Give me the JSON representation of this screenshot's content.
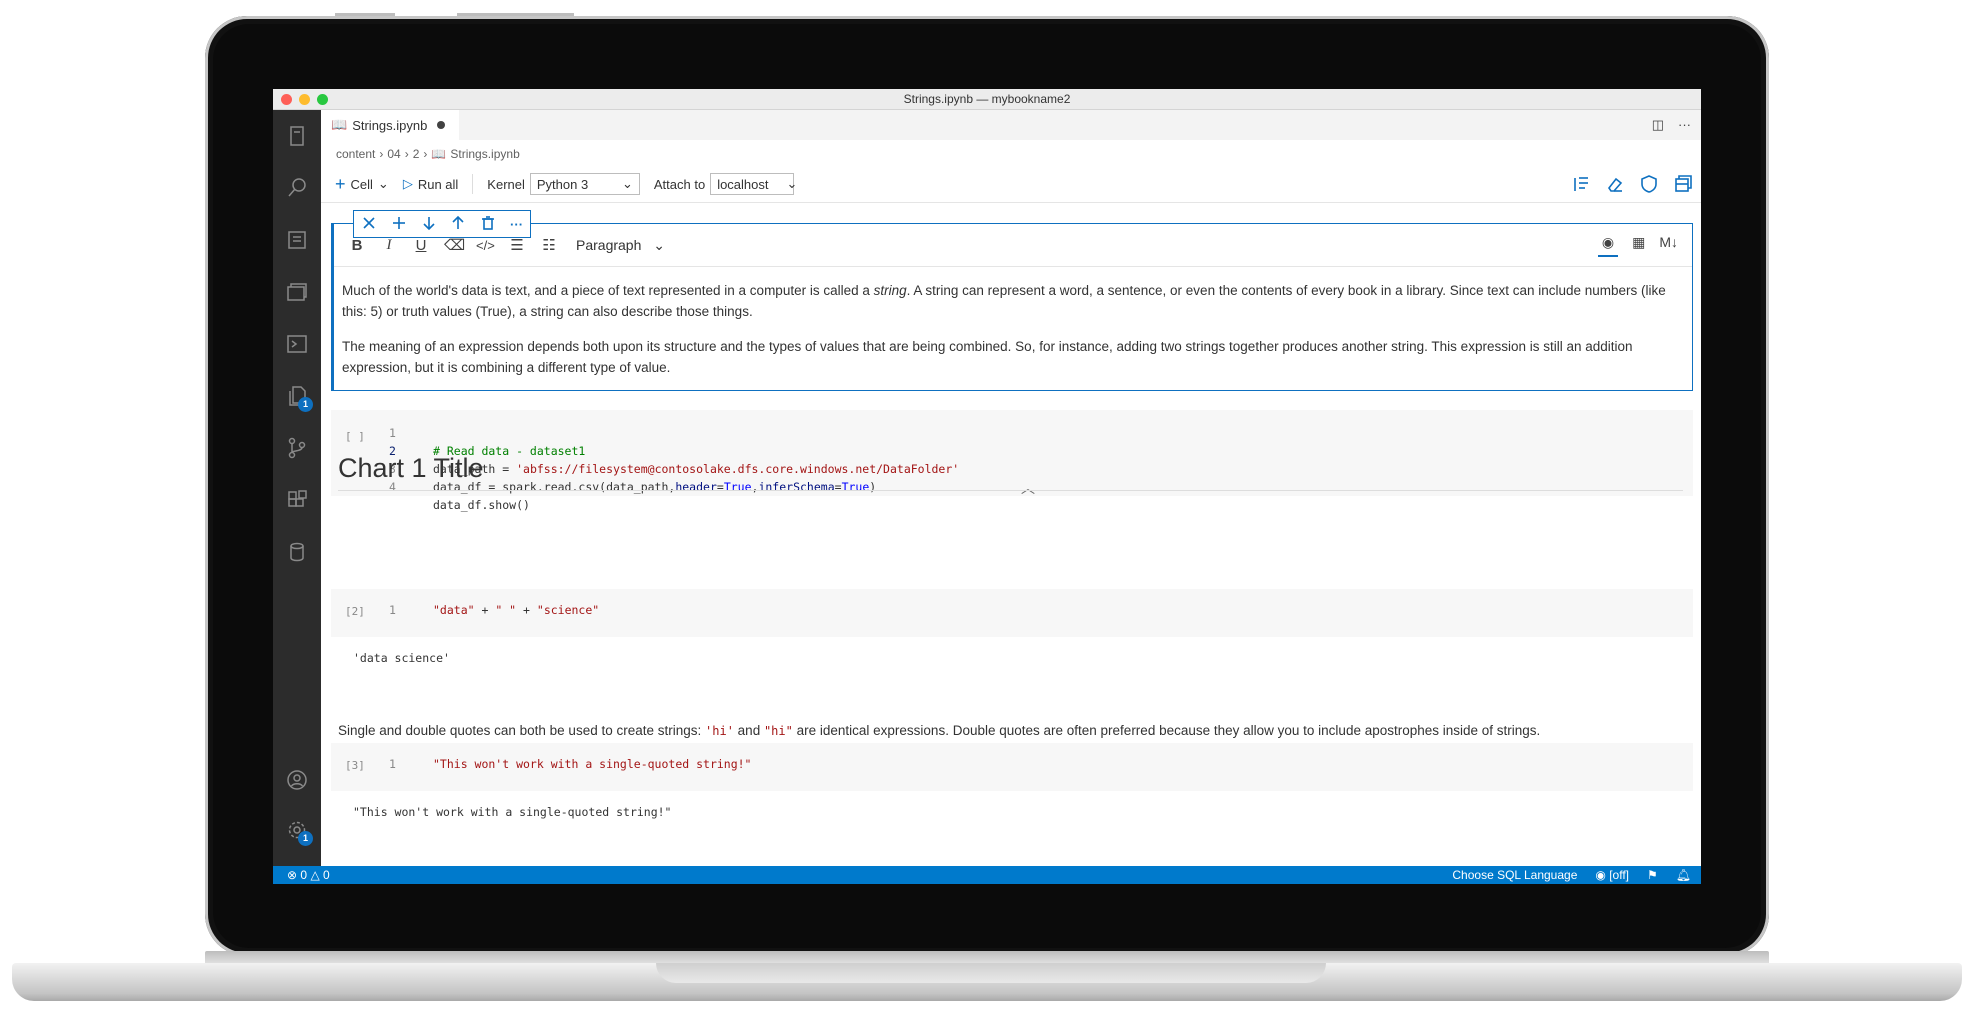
{
  "window": {
    "title": "Strings.ipynb — mybookname2"
  },
  "tab": {
    "label": "Strings.ipynb"
  },
  "breadcrumb": [
    "content",
    "04",
    "2",
    "Strings.ipynb"
  ],
  "toolbar": {
    "cell_label": "Cell",
    "run_all_label": "Run all",
    "kernel_label": "Kernel",
    "kernel_value": "Python 3",
    "attach_label": "Attach to",
    "attach_value": "localhost"
  },
  "format": {
    "paragraph": "Paragraph",
    "md_label": "M↓"
  },
  "markdown_cell": {
    "p1_a": "Much of the world's data is text, and a piece of text represented in a computer is called a ",
    "p1_em": "string",
    "p1_b": ". A string can represent a word, a sentence, or even the contents of every book in a library. Since text can include numbers (like this: 5) or truth values (True), a string can also describe those things.",
    "p2": "The meaning of an expression depends both upon its structure and the types of values that are being combined. So, for instance, adding two strings together produces another string. This expression is still an addition expression, but it is combining a different type of value."
  },
  "code_cell_1": {
    "exec": "[ ]",
    "lines": [
      "1",
      "2",
      "3",
      "4"
    ],
    "l1": "# Read data - dataset1",
    "l2a": "data_path = ",
    "l2b": "'abfss://filesystem@contosolake.dfs.core.windows.net/DataFolder'",
    "l3a": "data_df = spark.read.csv(data_path,",
    "l3b": "header",
    "l3c": "=",
    "l3d": "True",
    "l3e": ",",
    "l3f": "inferSchema",
    "l3g": "=",
    "l3h": "True",
    "l3i": ")",
    "l4": "data_df.show()"
  },
  "heading": "Chart 1 Title",
  "code_cell_2": {
    "exec": "[2]",
    "line": "1",
    "s1": "\"data\"",
    "op1": " + ",
    "s2": "\" \"",
    "op2": " + ",
    "s3": "\"science\"",
    "output": "'data science'"
  },
  "paragraph": {
    "a": "Single and double quotes can both be used to create strings: ",
    "c1": "'hi'",
    "b": " and ",
    "c2": "\"hi\"",
    "c": " are identical expressions. Double quotes are often preferred because they allow you to include apostrophes inside of strings."
  },
  "code_cell_3": {
    "exec": "[3]",
    "line": "1",
    "code": "\"This won't work with a single-quoted string!\"",
    "output": "\"This won't work with a single-quoted string!\""
  },
  "status": {
    "errors": "0",
    "warnings": "0",
    "sql_language": "Choose SQL Language",
    "preview": "[off]"
  },
  "badges": {
    "explorer": "1",
    "settings": "1"
  },
  "colors": {
    "accent": "#0e70c0",
    "status_bar": "#007acc",
    "activity_bar": "#2c2c2c"
  }
}
